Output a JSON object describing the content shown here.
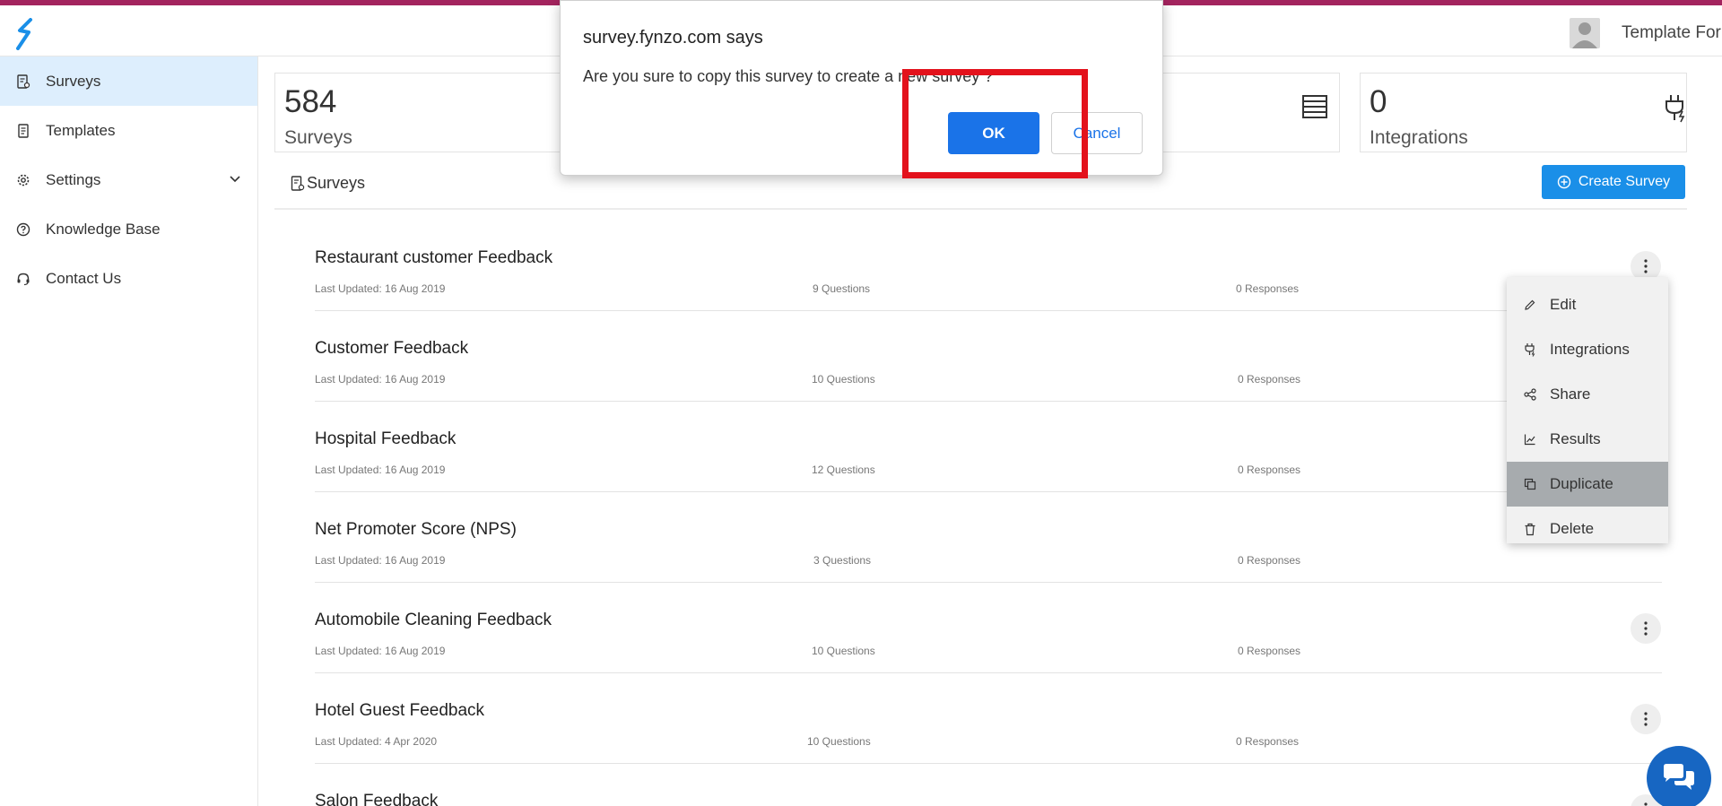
{
  "header": {
    "user_name": "Template For",
    "logo_icon": "fynzo-logo-icon",
    "top_strip_color": "#a3245e"
  },
  "sidebar": {
    "items": [
      {
        "label": "Surveys",
        "icon": "survey-doc-icon",
        "active": true
      },
      {
        "label": "Templates",
        "icon": "template-doc-icon"
      },
      {
        "label": "Settings",
        "icon": "gear-icon",
        "has_dropdown": true
      },
      {
        "label": "Knowledge Base",
        "icon": "question-circle-icon"
      },
      {
        "label": "Contact Us",
        "icon": "headset-icon"
      }
    ]
  },
  "stats": {
    "surveys": {
      "value": "584",
      "label": "Surveys"
    },
    "integrations": {
      "value": "0",
      "label": "Integrations"
    }
  },
  "list": {
    "title": "Surveys",
    "create_button": "Create Survey",
    "surveys": [
      {
        "name": "Restaurant customer Feedback",
        "updated": "Last Updated: 16 Aug 2019",
        "questions": "9 Questions",
        "responses": "0 Responses"
      },
      {
        "name": "Customer Feedback",
        "updated": "Last Updated: 16 Aug 2019",
        "questions": "10 Questions",
        "responses": "0 Responses"
      },
      {
        "name": "Hospital Feedback",
        "updated": "Last Updated: 16 Aug 2019",
        "questions": "12 Questions",
        "responses": "0 Responses"
      },
      {
        "name": "Net Promoter Score (NPS)",
        "updated": "Last Updated: 16 Aug 2019",
        "questions": "3 Questions",
        "responses": "0 Responses"
      },
      {
        "name": "Automobile Cleaning Feedback",
        "updated": "Last Updated: 16 Aug 2019",
        "questions": "10 Questions",
        "responses": "0 Responses"
      },
      {
        "name": "Hotel Guest Feedback",
        "updated": "Last Updated: 4 Apr 2020",
        "questions": "10 Questions",
        "responses": "0 Responses"
      },
      {
        "name": "Salon Feedback",
        "updated": "",
        "questions": "",
        "responses": ""
      }
    ]
  },
  "menu": {
    "items": [
      {
        "label": "Edit",
        "icon": "pencil-icon"
      },
      {
        "label": "Integrations",
        "icon": "plug-icon"
      },
      {
        "label": "Share",
        "icon": "share-icon"
      },
      {
        "label": "Results",
        "icon": "chart-line-icon"
      },
      {
        "label": "Duplicate",
        "icon": "copy-icon",
        "highlighted": true
      },
      {
        "label": "Delete",
        "icon": "trash-icon"
      }
    ]
  },
  "dialog": {
    "title": "survey.fynzo.com says",
    "message": "Are you sure to copy this survey to create a new survey ?",
    "ok": "OK",
    "cancel": "Cancel"
  },
  "colors": {
    "accent": "#1a8fe8",
    "dialog_button": "#1a73e8",
    "highlight_box": "#e3121c",
    "chat": "#1766c2"
  }
}
